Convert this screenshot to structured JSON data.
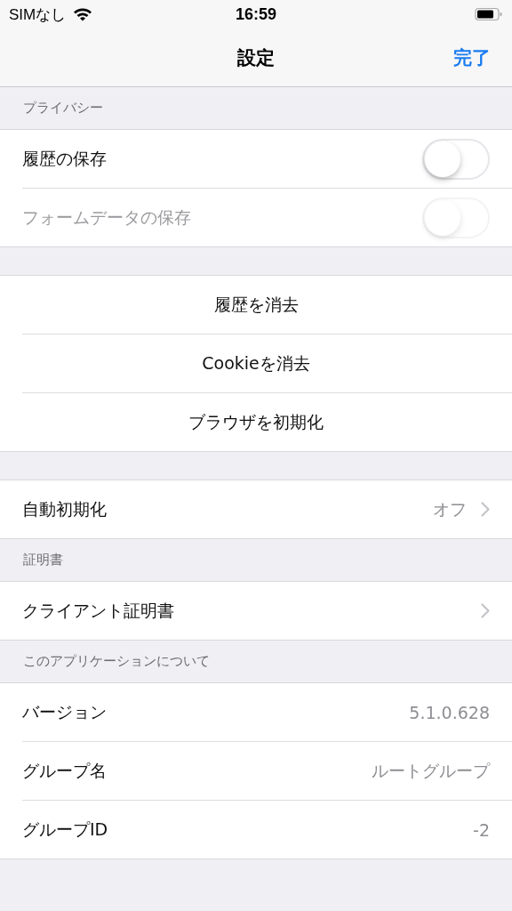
{
  "status_bar": {
    "carrier": "SIMなし",
    "time": "16:59"
  },
  "nav": {
    "title": "設定",
    "done": "完了"
  },
  "sections": [
    {
      "header": "プライバシー",
      "rows": [
        {
          "kind": "toggle",
          "label": "履歴の保存",
          "on": false,
          "disabled": false
        },
        {
          "kind": "toggle",
          "label": "フォームデータの保存",
          "on": false,
          "disabled": true
        }
      ]
    },
    {
      "rows": [
        {
          "kind": "action",
          "label": "履歴を消去"
        },
        {
          "kind": "action",
          "label": "Cookieを消去"
        },
        {
          "kind": "action",
          "label": "ブラウザを初期化"
        }
      ]
    },
    {
      "rows": [
        {
          "kind": "detail",
          "label": "自動初期化",
          "value": "オフ"
        }
      ]
    },
    {
      "header": "証明書",
      "rows": [
        {
          "kind": "detail",
          "label": "クライアント証明書"
        }
      ]
    },
    {
      "header": "このアプリケーションについて",
      "rows": [
        {
          "kind": "info",
          "label": "バージョン",
          "value": "5.1.0.628"
        },
        {
          "kind": "info",
          "label": "グループ名",
          "value": "ルートグループ"
        },
        {
          "kind": "info",
          "label": "グループID",
          "value": "-2"
        }
      ]
    }
  ]
}
